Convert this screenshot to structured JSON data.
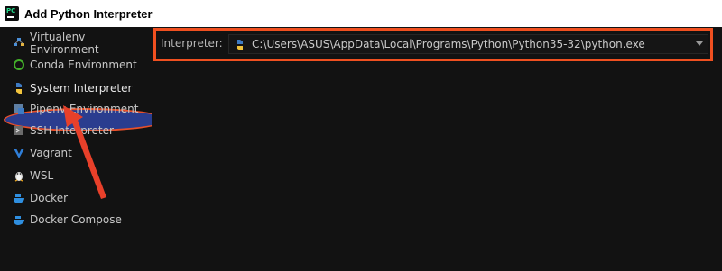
{
  "window": {
    "title": "Add Python Interpreter",
    "app_icon": "pycharm-icon"
  },
  "sidebar": {
    "items": [
      {
        "label": "Virtualenv Environment",
        "icon": "virtualenv-icon"
      },
      {
        "label": "Conda Environment",
        "icon": "conda-icon"
      },
      {
        "label": "System Interpreter",
        "icon": "python-icon",
        "selected": true
      },
      {
        "label": "Pipenv Environment",
        "icon": "pipenv-icon"
      },
      {
        "label": "SSH Interpreter",
        "icon": "ssh-icon"
      },
      {
        "label": "Vagrant",
        "icon": "vagrant-icon"
      },
      {
        "label": "WSL",
        "icon": "wsl-icon"
      },
      {
        "label": "Docker",
        "icon": "docker-icon"
      },
      {
        "label": "Docker Compose",
        "icon": "docker-compose-icon"
      }
    ]
  },
  "main": {
    "interpreter_label": "Interpreter:",
    "interpreter_value": "C:\\Users\\ASUS\\AppData\\Local\\Programs\\Python\\Python35-32\\python.exe"
  },
  "colors": {
    "annotation": "#f05020",
    "selection": "#2a3d8f",
    "background": "#121212"
  }
}
